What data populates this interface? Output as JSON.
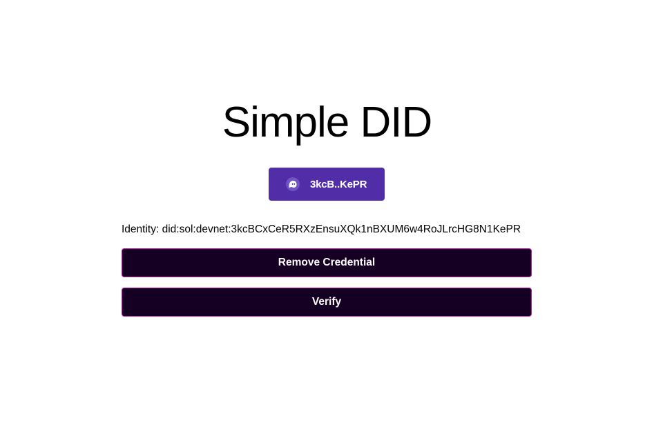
{
  "header": {
    "title": "Simple DID"
  },
  "wallet": {
    "address_short": "3kcB..KePR",
    "icon": "phantom-ghost-icon",
    "button_color": "#512da8"
  },
  "identity": {
    "text": "Identity: did:sol:devnet:3kcBCxCeR5RXzEnsuXQk1nBXUM6w4RoJLrcHG8N1KePR"
  },
  "actions": {
    "remove_label": "Remove Credential",
    "verify_label": "Verify",
    "button_bg": "#150024",
    "button_border": "#b5179e"
  }
}
